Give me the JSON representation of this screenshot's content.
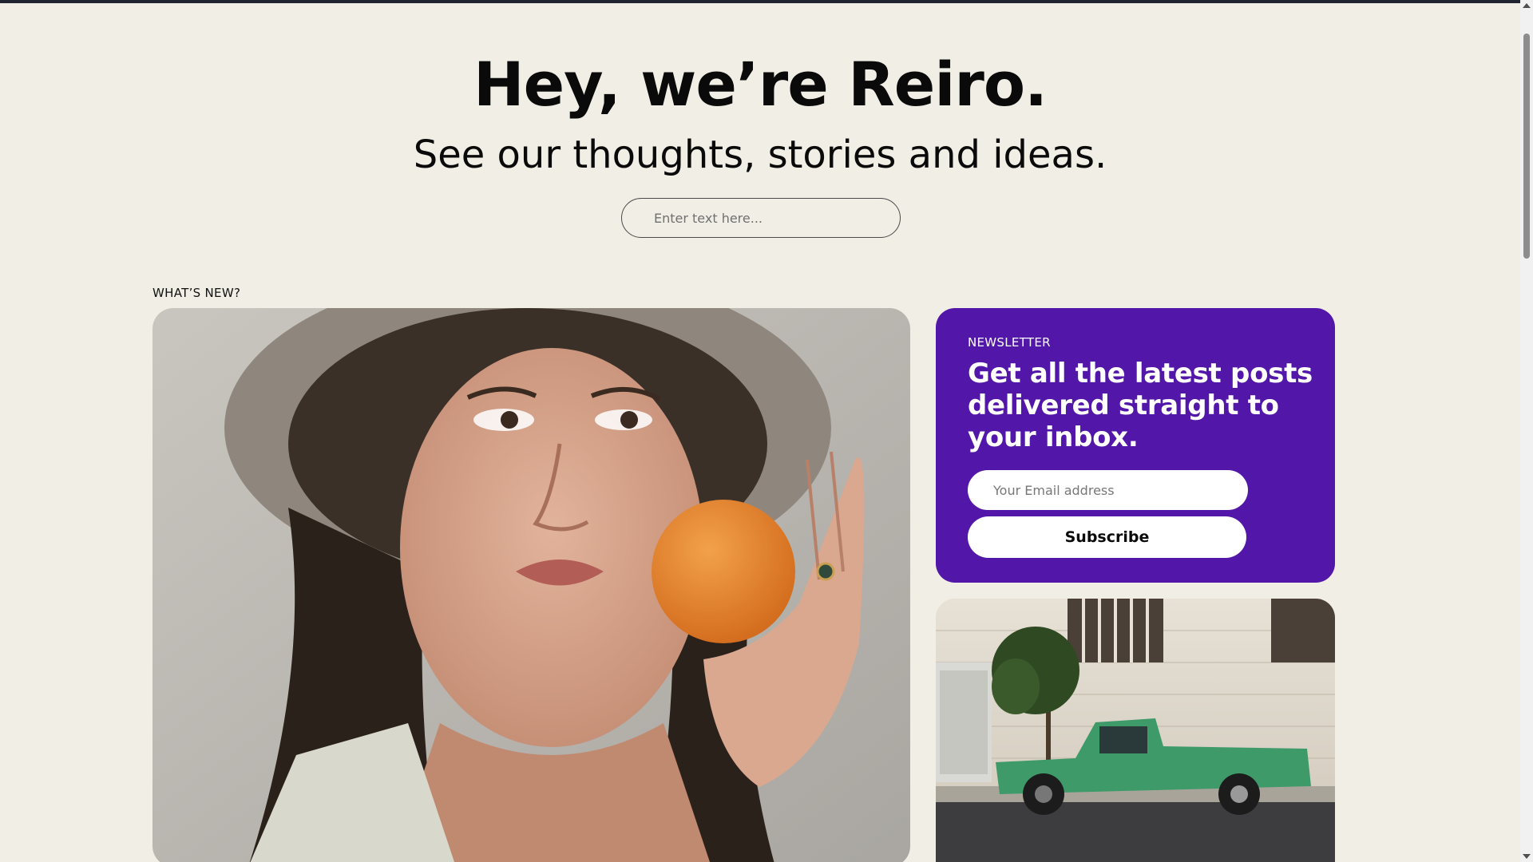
{
  "hero": {
    "title": "Hey, we’re Reiro.",
    "subtitle": "See our thoughts, stories and ideas.",
    "search_placeholder": "Enter text here..."
  },
  "section": {
    "label": "WHAT’S NEW?"
  },
  "newsletter": {
    "label": "NEWSLETTER",
    "title": "Get all the latest posts delivered straight to your inbox.",
    "email_placeholder": "Your Email address",
    "subscribe_label": "Subscribe"
  },
  "colors": {
    "background": "#f1eee5",
    "newsletter_bg": "#5216a8",
    "text": "#0a0a0a"
  },
  "images": {
    "feature": "woman-with-hat-and-orange-photo",
    "card": "green-pickup-truck-photo"
  }
}
